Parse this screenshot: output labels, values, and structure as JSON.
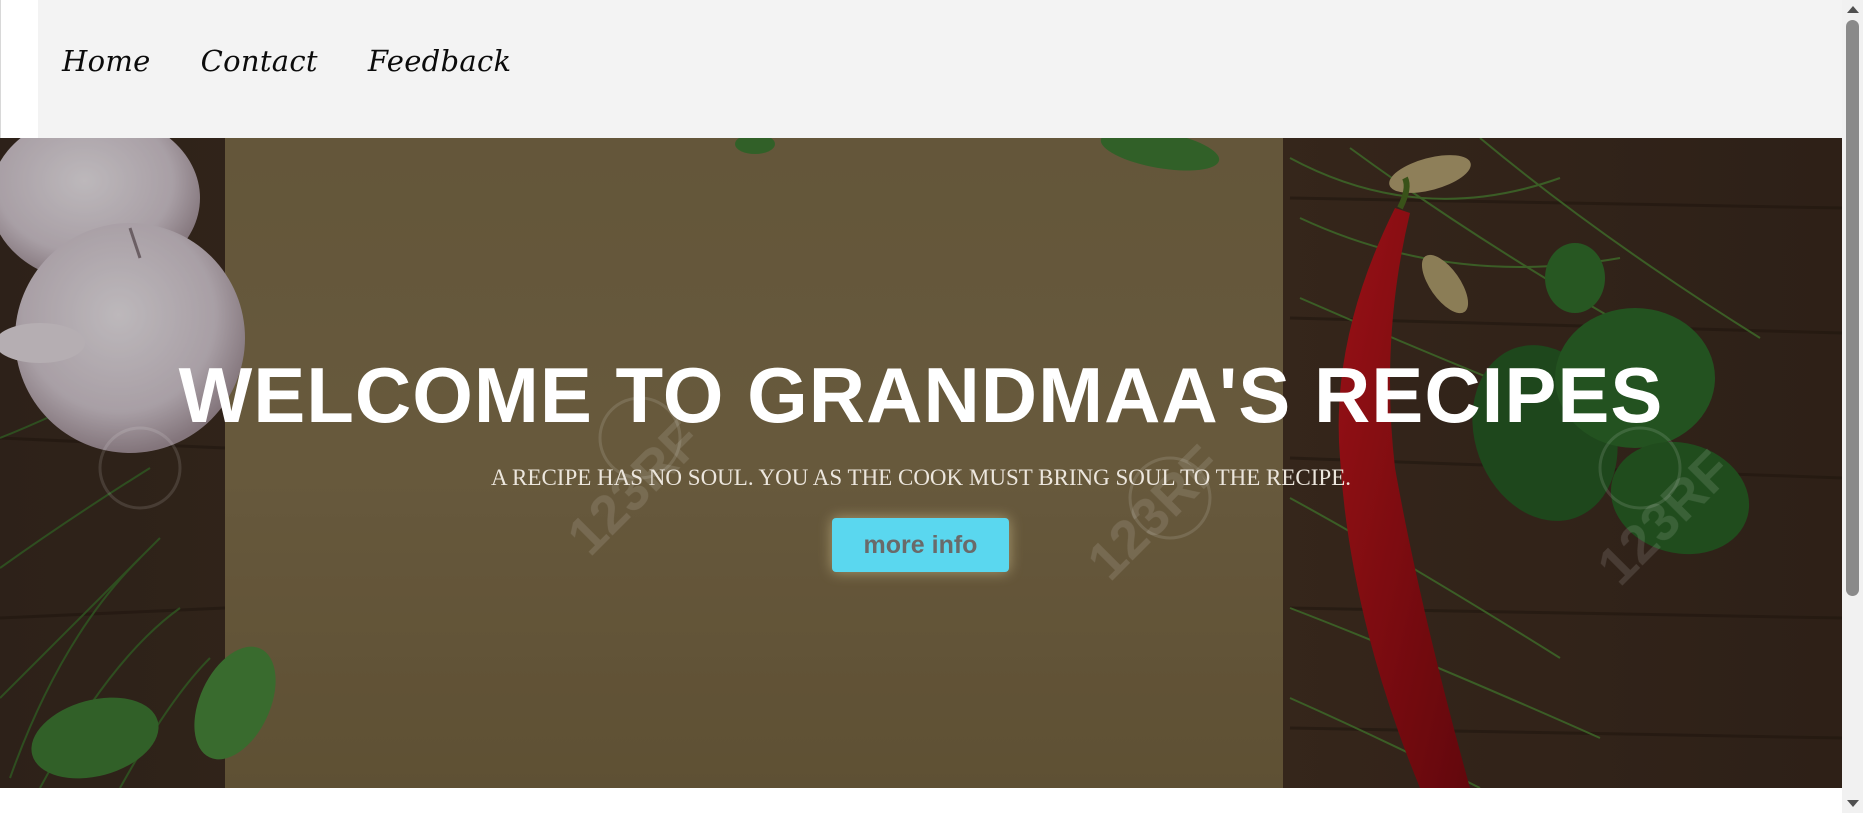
{
  "nav": {
    "items": [
      {
        "label": "Home"
      },
      {
        "label": "Contact"
      },
      {
        "label": "Feedback"
      }
    ]
  },
  "hero": {
    "title": "WELCOME TO GRANDMAA'S RECIPES",
    "subtitle": "A RECIPE HAS NO SOUL. YOU AS THE COOK MUST BRING SOUL TO THE RECIPE.",
    "button_label": "more info",
    "background_icon": "food-background-image",
    "watermark_text": "123RF"
  },
  "colors": {
    "nav_background": "#f3f3f3",
    "button_background": "#5ad7ef",
    "title_color": "#ffffff"
  }
}
